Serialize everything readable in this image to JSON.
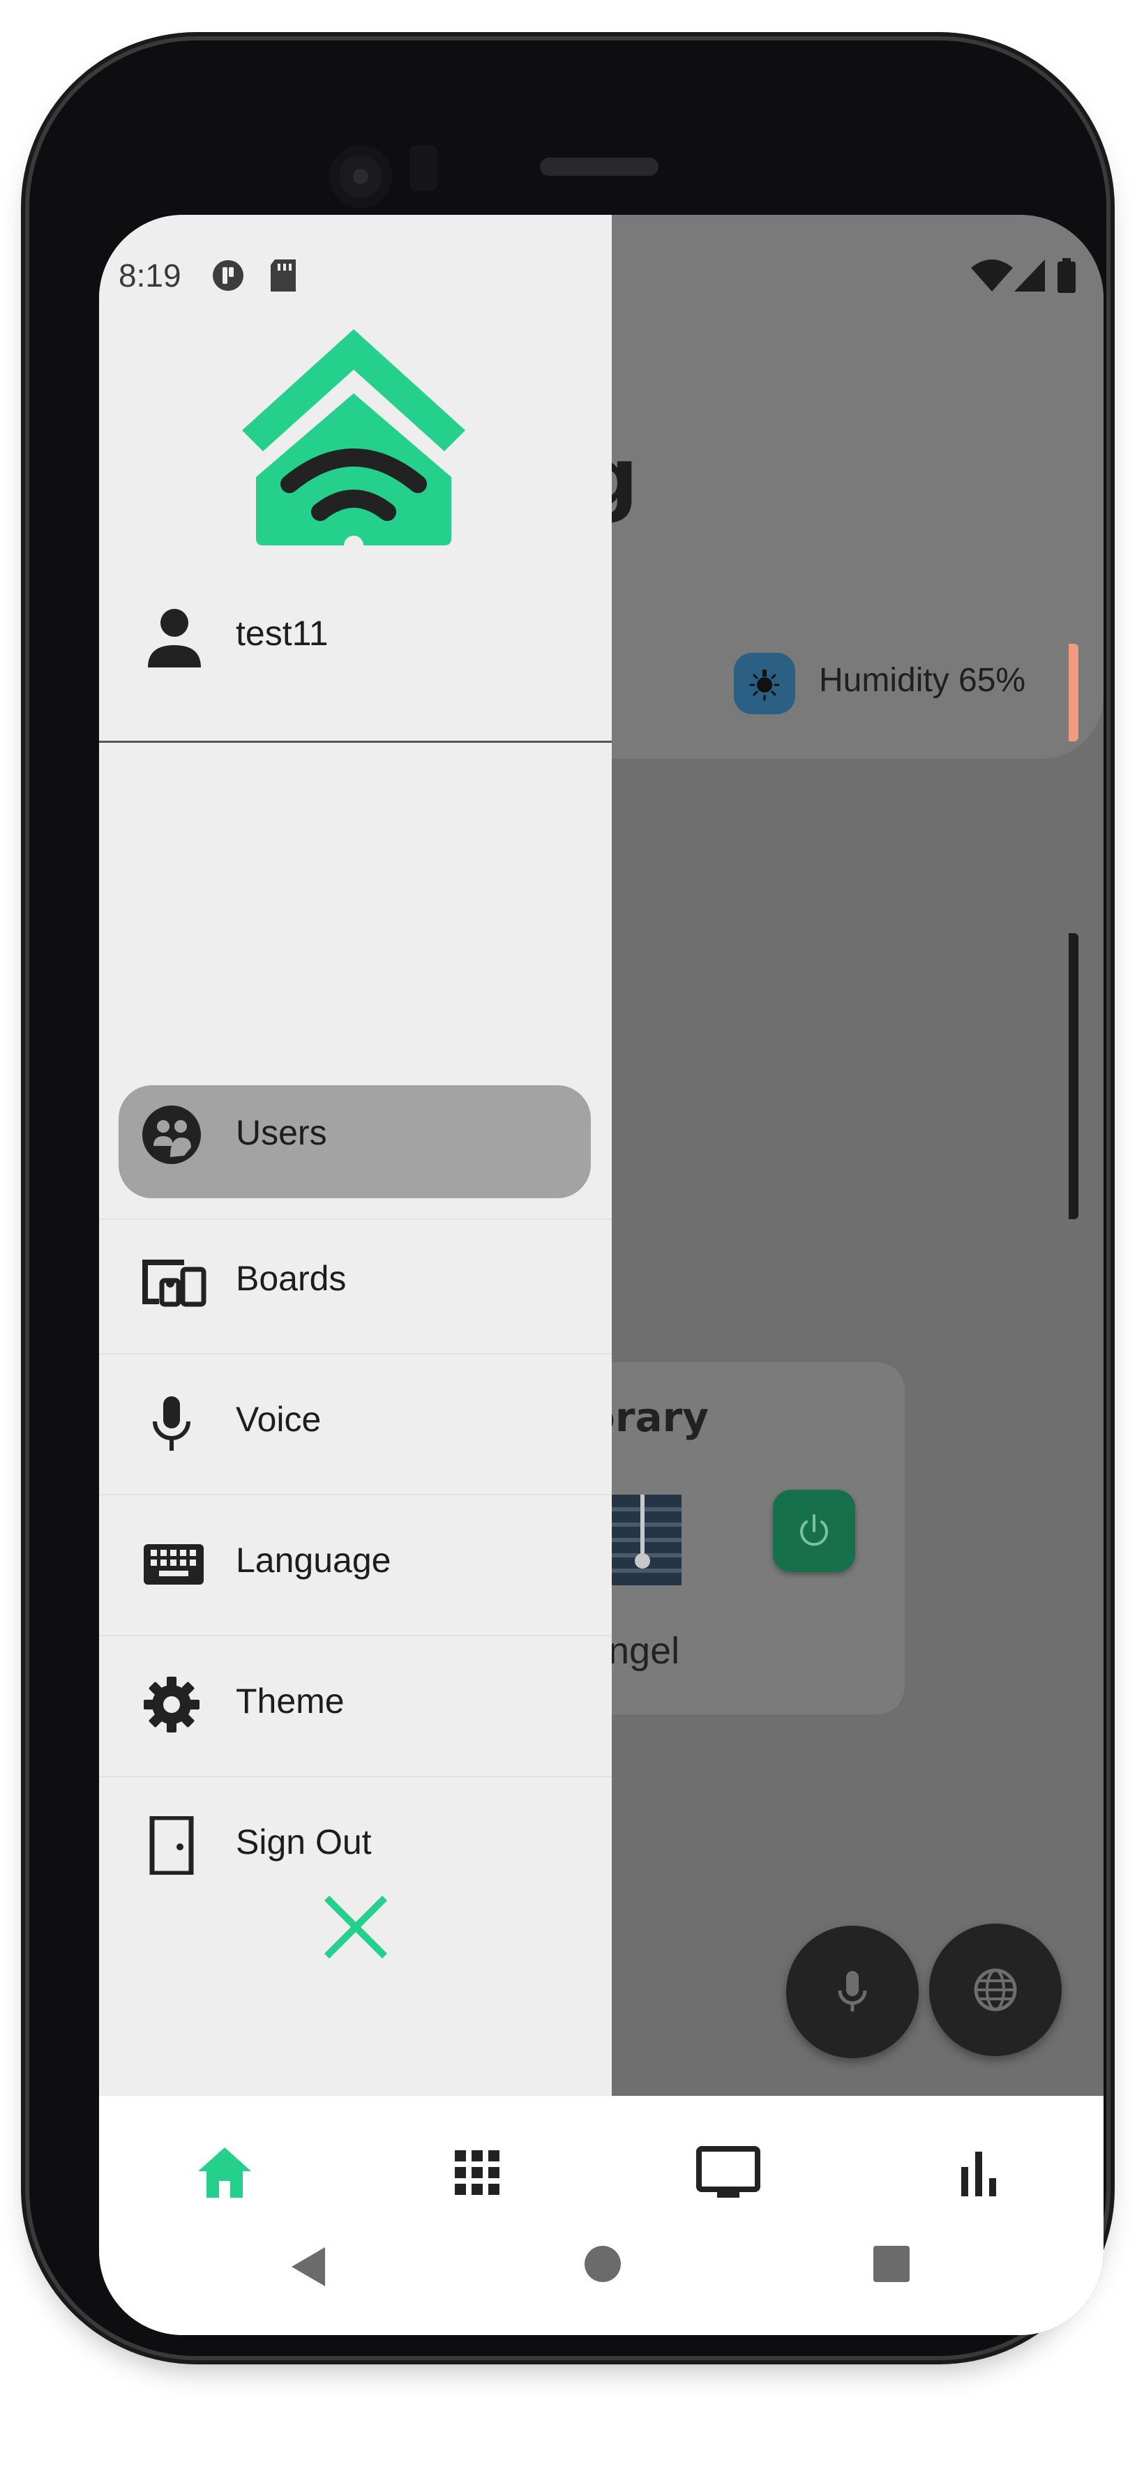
{
  "status_bar": {
    "time": "8:19"
  },
  "background_app": {
    "title_fragment": "g",
    "humidity": "Humidity 65%",
    "card_title_fragment": "orary",
    "card_label_fragment": "ngel"
  },
  "drawer": {
    "username": "test11",
    "menu": [
      {
        "label": "Users",
        "icon": "users-icon",
        "active": true
      },
      {
        "label": "Boards",
        "icon": "devices-icon",
        "active": false
      },
      {
        "label": "Voice",
        "icon": "microphone-icon",
        "active": false
      },
      {
        "label": "Language",
        "icon": "keyboard-icon",
        "active": false
      },
      {
        "label": "Theme",
        "icon": "gear-icon",
        "active": false
      },
      {
        "label": "Sign Out",
        "icon": "door-icon",
        "active": false
      }
    ],
    "close_icon": "close-icon"
  },
  "bottom_nav": {
    "items": [
      {
        "icon": "home-icon",
        "active": true
      },
      {
        "icon": "grid-icon",
        "active": false
      },
      {
        "icon": "monitor-icon",
        "active": false
      },
      {
        "icon": "bar-chart-icon",
        "active": false
      }
    ]
  },
  "colors": {
    "accent": "#25d08d",
    "drawer_bg": "#eeeeee",
    "active_pill": "#a3a3a3",
    "scrim": "#6f6f6f"
  }
}
